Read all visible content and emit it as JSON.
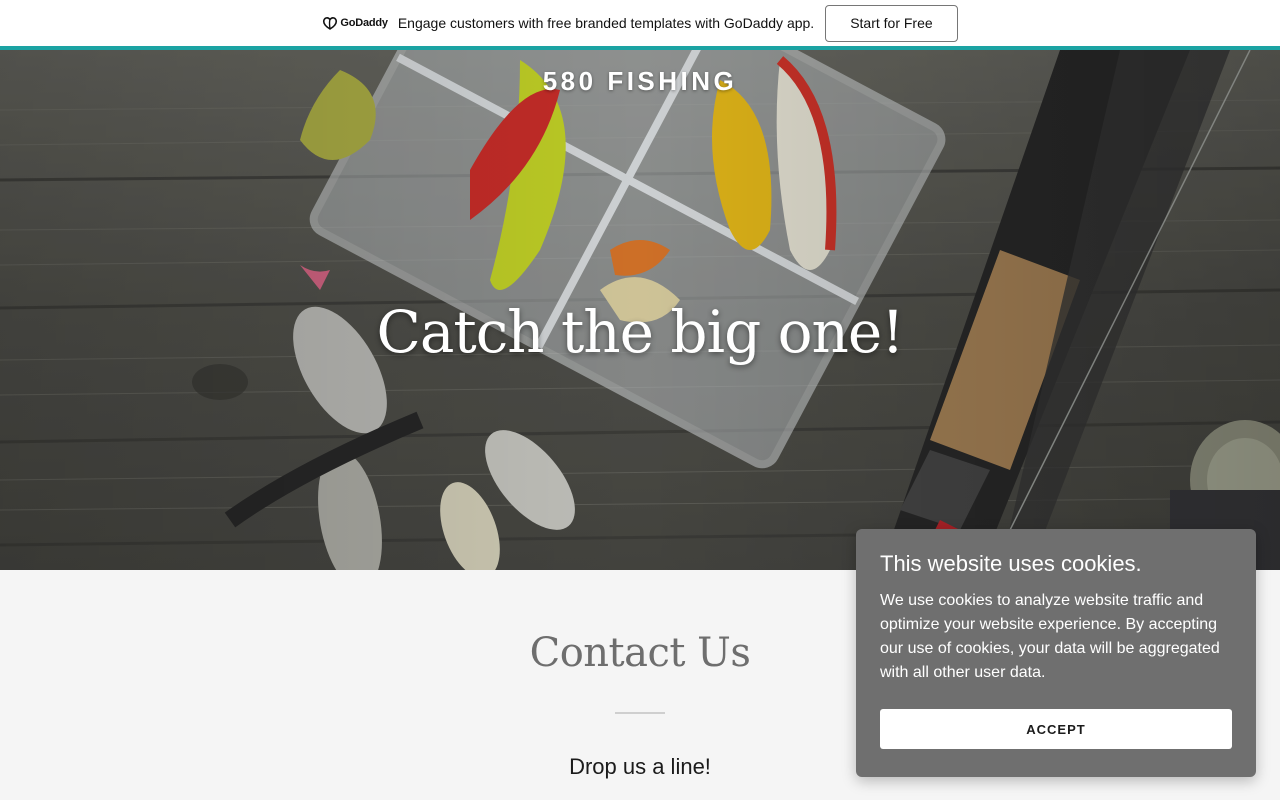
{
  "promo": {
    "logo_icon": "godaddy-logo-icon",
    "logo_text": "GoDaddy",
    "message": "Engage customers with free branded templates with GoDaddy app.",
    "cta_label": "Start for Free",
    "accent_color": "#1ba3a3"
  },
  "hero": {
    "site_title": "580 FISHING",
    "heading": "Catch the big one!"
  },
  "contact": {
    "title": "Contact Us",
    "subtitle": "Drop us a line!"
  },
  "cookie": {
    "title": "This website uses cookies.",
    "body": "We use cookies to analyze website traffic and optimize your website experience. By accepting our use of cookies, your data will be aggregated with all other user data.",
    "accept_label": "ACCEPT",
    "background_color": "#6f6f6f"
  }
}
